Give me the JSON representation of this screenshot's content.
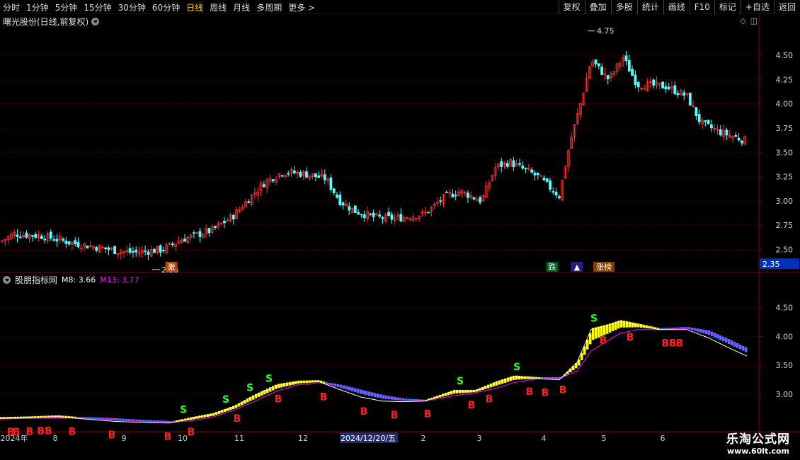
{
  "toolbar": {
    "periods": [
      "分时",
      "1分钟",
      "5分钟",
      "15分钟",
      "30分钟",
      "60分钟",
      "日线",
      "周线",
      "月线",
      "多周期",
      "更多 >"
    ],
    "active_period": "日线",
    "buttons": [
      "复权",
      "叠加",
      "多股",
      "统计",
      "画线",
      "F10",
      "标记",
      "+自选",
      "返回"
    ]
  },
  "stock": {
    "title": "曙光股份(日线,前复权)"
  },
  "indicator": {
    "name": "股朋指标网",
    "m8_label": "M8: 3.66",
    "m13_label": "M13: 3.77"
  },
  "price_tag": "2.35",
  "high_label": "4.75",
  "low_label": "2.25",
  "events": [
    {
      "text": "激",
      "bg": "#c04000"
    },
    {
      "text": "跌",
      "bg": "#006020"
    },
    {
      "text": "▲",
      "bg": "#202080"
    },
    {
      "text": "涨榜",
      "bg": "#804000"
    }
  ],
  "watermark": {
    "title": "乐淘公式网",
    "url": "www.60lt.com"
  },
  "colors": {
    "up": "#ff3232",
    "down": "#54ffff",
    "m8": "#ffffff",
    "m13": "#ff00ff",
    "buy": "#ff2020",
    "sell": "#20ff20",
    "yellow": "#ffff00",
    "blue": "#4080ff"
  },
  "chart_data": [
    {
      "type": "candlestick",
      "title": "曙光股份(日线,前复权)",
      "ylim": [
        2.3,
        4.85
      ],
      "y_ticks": [
        2.5,
        2.75,
        3.0,
        3.25,
        3.5,
        3.75,
        4.0,
        4.25,
        4.5
      ],
      "x_labels": [
        "2024年",
        "8",
        "9",
        "10",
        "11",
        "12",
        "2024/12/20/五",
        "2",
        "3",
        "4",
        "5",
        "6"
      ],
      "approx_close_path": [
        [
          0,
          2.58
        ],
        [
          20,
          2.66
        ],
        [
          60,
          2.64
        ],
        [
          100,
          2.57
        ],
        [
          140,
          2.52
        ],
        [
          170,
          2.48
        ],
        [
          190,
          2.47
        ],
        [
          230,
          2.5
        ],
        [
          255,
          2.6
        ],
        [
          300,
          2.7
        ],
        [
          330,
          2.85
        ],
        [
          355,
          3.05
        ],
        [
          375,
          3.2
        ],
        [
          400,
          3.3
        ],
        [
          430,
          3.28
        ],
        [
          460,
          3.23
        ],
        [
          480,
          3.0
        ],
        [
          500,
          2.9
        ],
        [
          530,
          2.83
        ],
        [
          560,
          2.82
        ],
        [
          600,
          2.87
        ],
        [
          630,
          3.05
        ],
        [
          650,
          3.1
        ],
        [
          680,
          3.0
        ],
        [
          700,
          3.35
        ],
        [
          720,
          3.4
        ],
        [
          760,
          3.25
        ],
        [
          790,
          3.05
        ],
        [
          805,
          3.6
        ],
        [
          820,
          4.0
        ],
        [
          835,
          4.45
        ],
        [
          860,
          4.25
        ],
        [
          880,
          4.48
        ],
        [
          900,
          4.2
        ],
        [
          940,
          4.18
        ],
        [
          970,
          4.08
        ],
        [
          990,
          3.8
        ],
        [
          1020,
          3.7
        ],
        [
          1050,
          3.63
        ]
      ]
    },
    {
      "type": "line",
      "title": "股朋指标网",
      "ylim": [
        2.35,
        4.95
      ],
      "y_ticks": [
        3.0,
        3.5,
        4.0,
        4.5
      ],
      "series": [
        {
          "name": "M8",
          "values": [
            [
              0,
              2.58
            ],
            [
              40,
              2.59
            ],
            [
              80,
              2.61
            ],
            [
              120,
              2.57
            ],
            [
              160,
              2.53
            ],
            [
              200,
              2.51
            ],
            [
              240,
              2.5
            ],
            [
              270,
              2.58
            ],
            [
              300,
              2.65
            ],
            [
              330,
              2.78
            ],
            [
              360,
              2.98
            ],
            [
              390,
              3.15
            ],
            [
              420,
              3.21
            ],
            [
              450,
              3.22
            ],
            [
              480,
              3.08
            ],
            [
              510,
              2.95
            ],
            [
              540,
              2.88
            ],
            [
              570,
              2.87
            ],
            [
              600,
              2.88
            ],
            [
              640,
              3.05
            ],
            [
              670,
              3.05
            ],
            [
              700,
              3.2
            ],
            [
              725,
              3.3
            ],
            [
              760,
              3.27
            ],
            [
              790,
              3.25
            ],
            [
              815,
              3.55
            ],
            [
              835,
              4.12
            ],
            [
              855,
              4.18
            ],
            [
              875,
              4.26
            ],
            [
              900,
              4.2
            ],
            [
              930,
              4.12
            ],
            [
              970,
              4.12
            ],
            [
              1000,
              3.98
            ],
            [
              1030,
              3.8
            ],
            [
              1055,
              3.66
            ]
          ]
        },
        {
          "name": "M13",
          "values": [
            [
              0,
              2.57
            ],
            [
              40,
              2.58
            ],
            [
              80,
              2.59
            ],
            [
              120,
              2.58
            ],
            [
              160,
              2.56
            ],
            [
              200,
              2.53
            ],
            [
              240,
              2.51
            ],
            [
              270,
              2.54
            ],
            [
              300,
              2.6
            ],
            [
              330,
              2.72
            ],
            [
              360,
              2.88
            ],
            [
              390,
              3.05
            ],
            [
              420,
              3.16
            ],
            [
              450,
              3.2
            ],
            [
              480,
              3.14
            ],
            [
              510,
              3.05
            ],
            [
              540,
              2.96
            ],
            [
              570,
              2.9
            ],
            [
              600,
              2.88
            ],
            [
              640,
              2.97
            ],
            [
              670,
              3.02
            ],
            [
              700,
              3.1
            ],
            [
              725,
              3.2
            ],
            [
              760,
              3.27
            ],
            [
              790,
              3.27
            ],
            [
              815,
              3.4
            ],
            [
              835,
              3.75
            ],
            [
              855,
              3.9
            ],
            [
              875,
              4.05
            ],
            [
              900,
              4.12
            ],
            [
              930,
              4.12
            ],
            [
              970,
              4.14
            ],
            [
              1000,
              4.08
            ],
            [
              1030,
              3.92
            ],
            [
              1055,
              3.77
            ]
          ]
        }
      ],
      "signals": [
        {
          "x": 15,
          "t": "B"
        },
        {
          "x": 23,
          "t": "B"
        },
        {
          "x": 42,
          "t": "B"
        },
        {
          "x": 63,
          "t": "BB"
        },
        {
          "x": 102,
          "t": "B"
        },
        {
          "x": 158,
          "t": "B"
        },
        {
          "x": 237,
          "t": "B"
        },
        {
          "x": 259,
          "t": "S"
        },
        {
          "x": 270,
          "t": "B"
        },
        {
          "x": 319,
          "t": "S"
        },
        {
          "x": 335,
          "t": "B"
        },
        {
          "x": 353,
          "t": "S"
        },
        {
          "x": 380,
          "t": "S"
        },
        {
          "x": 393,
          "t": "B"
        },
        {
          "x": 457,
          "t": "B"
        },
        {
          "x": 514,
          "t": "B"
        },
        {
          "x": 557,
          "t": "B"
        },
        {
          "x": 604,
          "t": "B"
        },
        {
          "x": 650,
          "t": "S"
        },
        {
          "x": 666,
          "t": "B"
        },
        {
          "x": 691,
          "t": "B"
        },
        {
          "x": 730,
          "t": "S"
        },
        {
          "x": 748,
          "t": "B"
        },
        {
          "x": 770,
          "t": "B"
        },
        {
          "x": 795,
          "t": "B"
        },
        {
          "x": 839,
          "t": "S"
        },
        {
          "x": 852,
          "t": "B"
        },
        {
          "x": 890,
          "t": "B"
        },
        {
          "x": 945,
          "t": "BB"
        },
        {
          "x": 960,
          "t": "B"
        }
      ]
    }
  ]
}
